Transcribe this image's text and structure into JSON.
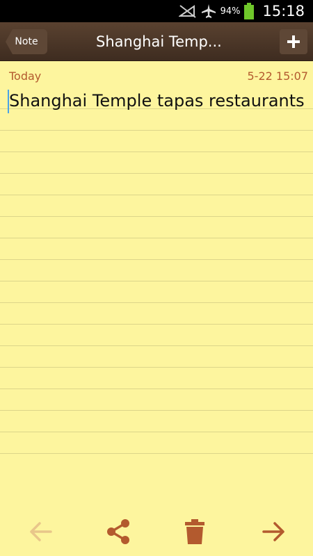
{
  "status_bar": {
    "battery_pct": "94%",
    "time": "15:18"
  },
  "action_bar": {
    "back_label": "Note",
    "title": "Shanghai Temp..."
  },
  "note": {
    "date_label": "Today",
    "timestamp": "5-22 15:07",
    "text": "Shanghai Temple tapas restaurants"
  },
  "icons": {
    "no_signal": "no-signal-icon",
    "airplane": "airplane-mode-icon",
    "battery": "battery-icon",
    "add": "plus-icon",
    "prev": "arrow-left-icon",
    "share": "share-icon",
    "delete": "trash-icon",
    "next": "arrow-right-icon"
  },
  "colors": {
    "paper": "#fdf59e",
    "accent": "#b35a2e",
    "bar": "#4a3527",
    "battery": "#6fc72a"
  }
}
